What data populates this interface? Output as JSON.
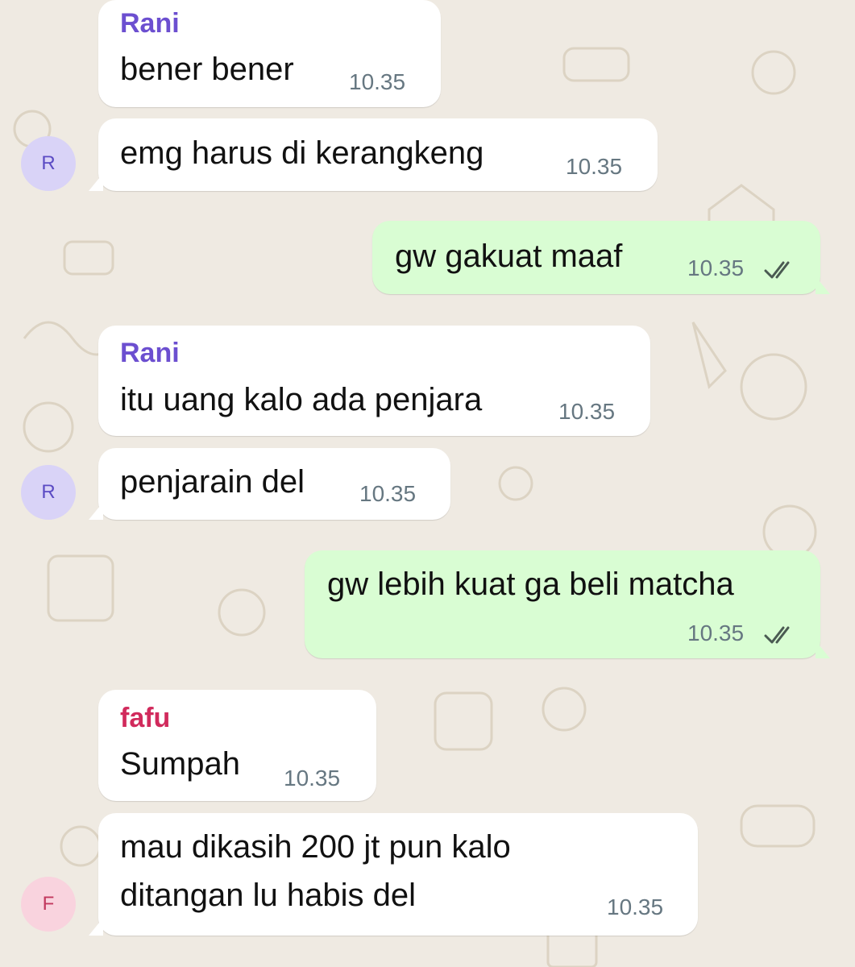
{
  "colors": {
    "background": "#efeae2",
    "incoming_bubble": "#ffffff",
    "outgoing_bubble": "#d9fdd3",
    "rani_name": "#6c4fd0",
    "fafu_name": "#d12a5c",
    "timestamp": "#667781",
    "read_ticks": "#4a5a52",
    "avatar_r_bg": "#d9d3f7",
    "avatar_r_text": "#5b4bc4",
    "avatar_f_bg": "#f9d3de",
    "avatar_f_text": "#c2385e"
  },
  "messages": [
    {
      "sender": "Rani",
      "text": "bener bener",
      "time": "10.35"
    },
    {
      "avatar": "R",
      "text": "emg harus di kerangkeng",
      "time": "10.35"
    },
    {
      "text": "gw gakuat maaf",
      "time": "10.35",
      "ticks_icon": "double-check-icon"
    },
    {
      "sender": "Rani",
      "text": "itu uang kalo ada penjara",
      "time": "10.35"
    },
    {
      "avatar": "R",
      "text": "penjarain del",
      "time": "10.35"
    },
    {
      "text": "gw lebih kuat ga beli matcha",
      "time": "10.35",
      "ticks_icon": "double-check-icon"
    },
    {
      "sender": "fafu",
      "text": "Sumpah",
      "time": "10.35"
    },
    {
      "avatar": "F",
      "text_lines": [
        "mau dikasih 200 jt pun kalo",
        "ditangan lu habis del"
      ],
      "time": "10.35"
    }
  ]
}
